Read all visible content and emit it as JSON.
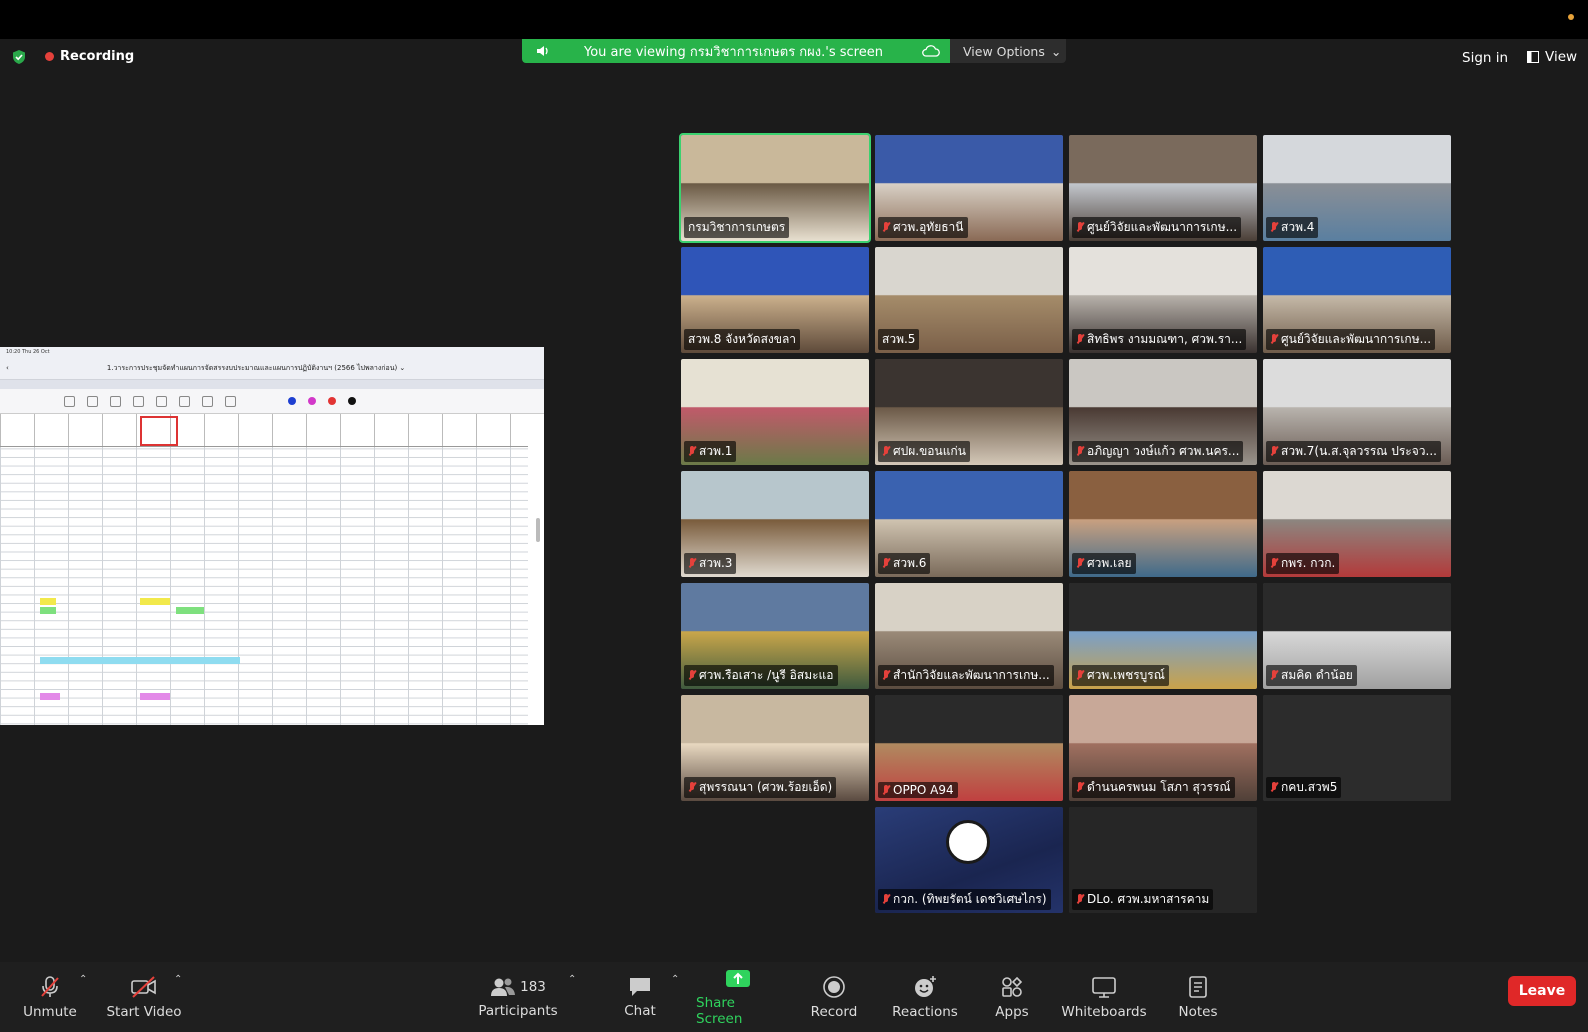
{
  "top": {
    "recording_label": "Recording",
    "viewing_text": "You are viewing กรมวิชาการเกษตร กผง.'s screen",
    "view_options_label": "View Options",
    "sign_in_label": "Sign in",
    "view_label": "View"
  },
  "shared_doc": {
    "status_time": "10:20  Thu 26 Oct",
    "title": "1.วาระการประชุมจัดทำแผนการจัดสรรงบประมาณและแผนการปฏิบัติงานฯ (2566 ไปพลางก่อน) ⌄"
  },
  "tiles": [
    {
      "name": "กรมวิชาการเกษตร",
      "muted": false,
      "active": true
    },
    {
      "name": "ศวพ.อุทัยธานี",
      "muted": true
    },
    {
      "name": "ศูนย์วิจัยและพัฒนาการเกษ...",
      "muted": true
    },
    {
      "name": "สวพ.4",
      "muted": true
    },
    {
      "name": "สวพ.8 จังหวัดสงขลา",
      "muted": false
    },
    {
      "name": "สวพ.5",
      "muted": false
    },
    {
      "name": "สิทธิพร งามมณฑา, ศวพ.รา...",
      "muted": true
    },
    {
      "name": "ศูนย์วิจัยและพัฒนาการเกษ...",
      "muted": true
    },
    {
      "name": "สวพ.1",
      "muted": true
    },
    {
      "name": "ศปผ.ขอนแก่น",
      "muted": true
    },
    {
      "name": "อภิญญา วงษ์แก้ว ศวพ.นคร...",
      "muted": true
    },
    {
      "name": "สวพ.7(น.ส.จุลวรรณ ประจว...",
      "muted": true
    },
    {
      "name": "สวพ.3",
      "muted": true
    },
    {
      "name": "สวพ.6",
      "muted": true
    },
    {
      "name": "ศวพ.เลย",
      "muted": true
    },
    {
      "name": "กพร. กวก.",
      "muted": true
    },
    {
      "name": "ศวพ.รือเสาะ /นูรี อิสมะแอ",
      "muted": true
    },
    {
      "name": "สำนักวิจัยและพัฒนาการเกษ...",
      "muted": true
    },
    {
      "name": "ศวพ.เพชรบูรณ์",
      "muted": true
    },
    {
      "name": "สมคิด ดำน้อย",
      "muted": true
    },
    {
      "name": "สุพรรณนา (ศวพ.ร้อยเอ็ด)",
      "muted": true
    },
    {
      "name": "OPPO A94",
      "muted": true
    },
    {
      "name": "ดำนนครพนม โสภา สุวรรณ์",
      "muted": true
    },
    {
      "name": "กคบ.สวพ5",
      "muted": true
    },
    {
      "name": "กวก. (ทิพยรัตน์ เดชวิเศษไกร)",
      "muted": true
    },
    {
      "name": "DLo. ศวพ.มหาสารคาม",
      "muted": true
    }
  ],
  "toolbar": {
    "unmute": "Unmute",
    "start_video": "Start Video",
    "participants_count": "183",
    "participants": "Participants",
    "chat": "Chat",
    "share_screen": "Share Screen",
    "record": "Record",
    "reactions": "Reactions",
    "apps": "Apps",
    "whiteboards": "Whiteboards",
    "notes": "Notes",
    "leave": "Leave"
  }
}
